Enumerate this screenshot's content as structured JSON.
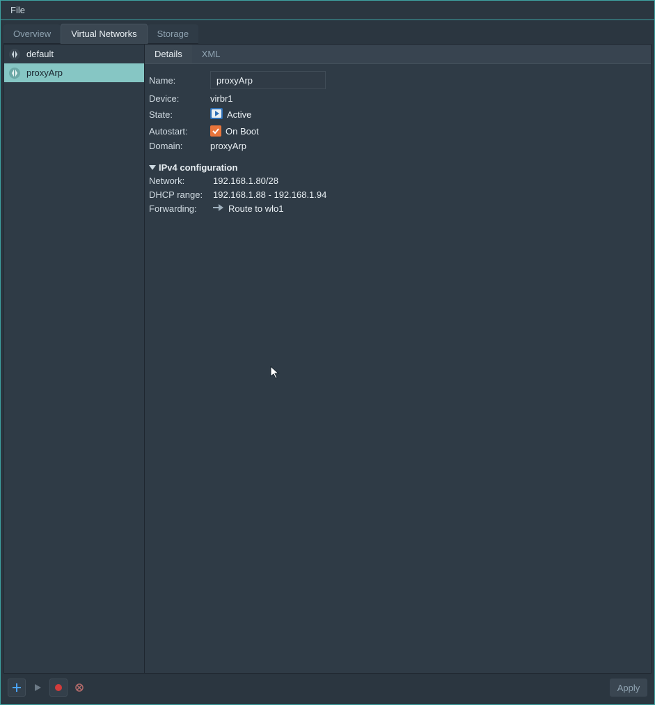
{
  "menubar": {
    "file": "File"
  },
  "tabs": {
    "overview": "Overview",
    "virtual_networks": "Virtual Networks",
    "storage": "Storage"
  },
  "sidebar": {
    "items": [
      {
        "label": "default"
      },
      {
        "label": "proxyArp"
      }
    ]
  },
  "subtabs": {
    "details": "Details",
    "xml": "XML"
  },
  "details": {
    "name_label": "Name:",
    "name_value": "proxyArp",
    "device_label": "Device:",
    "device_value": "virbr1",
    "state_label": "State:",
    "state_value": "Active",
    "autostart_label": "Autostart:",
    "autostart_value": "On Boot",
    "autostart_checked": true,
    "domain_label": "Domain:",
    "domain_value": "proxyArp"
  },
  "ipv4": {
    "header": "IPv4 configuration",
    "network_label": "Network:",
    "network_value": "192.168.1.80/28",
    "dhcp_label": "DHCP range:",
    "dhcp_value": "192.168.1.88 - 192.168.1.94",
    "forwarding_label": "Forwarding:",
    "forwarding_value": "Route to wlo1"
  },
  "footer": {
    "apply": "Apply"
  }
}
